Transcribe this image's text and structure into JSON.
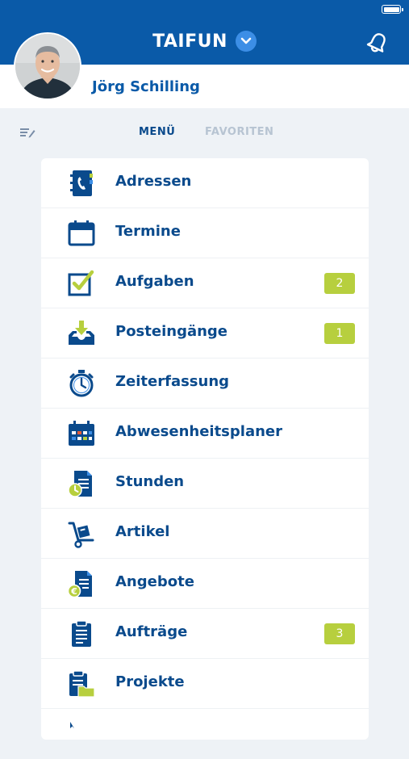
{
  "header": {
    "title": "TAIFUN",
    "colors": {
      "primary": "#0a5aa8",
      "accent": "#b7cf3e",
      "background": "#eef2f6"
    },
    "icons": {
      "battery": "battery-icon",
      "chevron": "chevron-down-icon",
      "bell": "bell-icon"
    }
  },
  "user": {
    "name": "Jörg Schilling",
    "avatar": "user-avatar"
  },
  "tabs": [
    {
      "label": "MENÜ",
      "active": true
    },
    {
      "label": "FAVORITEN",
      "active": false
    }
  ],
  "menu": {
    "items": [
      {
        "label": "Adressen",
        "icon": "address-book-icon",
        "badge": null
      },
      {
        "label": "Termine",
        "icon": "calendar-icon",
        "badge": null
      },
      {
        "label": "Aufgaben",
        "icon": "checkbox-icon",
        "badge": "2"
      },
      {
        "label": "Posteingänge",
        "icon": "inbox-download-icon",
        "badge": "1"
      },
      {
        "label": "Zeiterfassung",
        "icon": "stopwatch-icon",
        "badge": null
      },
      {
        "label": "Abwesenheitsplaner",
        "icon": "planner-calendar-icon",
        "badge": null
      },
      {
        "label": "Stunden",
        "icon": "document-clock-icon",
        "badge": null
      },
      {
        "label": "Artikel",
        "icon": "hand-truck-icon",
        "badge": null
      },
      {
        "label": "Angebote",
        "icon": "document-euro-icon",
        "badge": null
      },
      {
        "label": "Aufträge",
        "icon": "clipboard-icon",
        "badge": "3"
      },
      {
        "label": "Projekte",
        "icon": "clipboard-folder-icon",
        "badge": null
      }
    ]
  }
}
